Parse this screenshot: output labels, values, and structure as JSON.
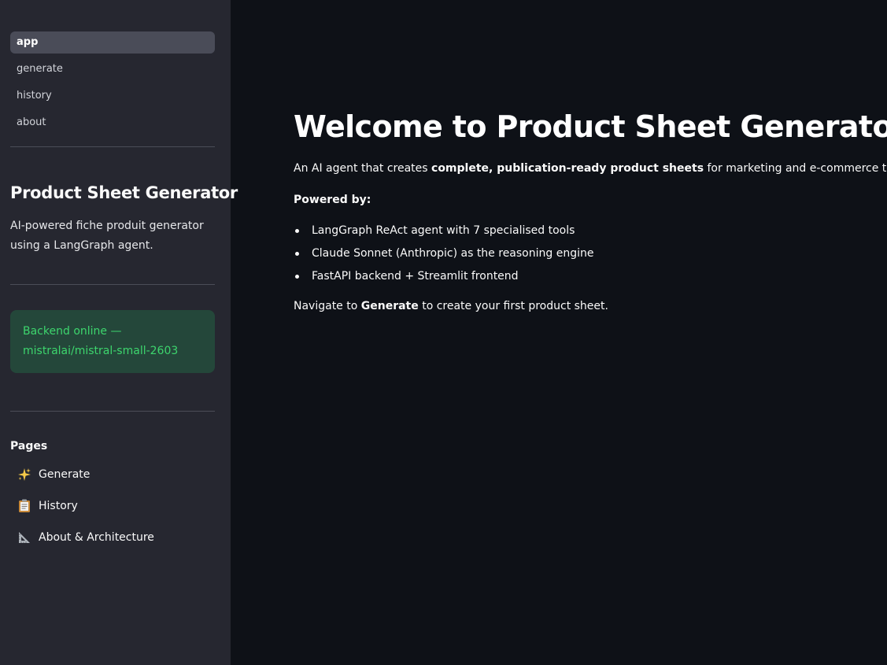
{
  "sidebar": {
    "nav": [
      {
        "label": "app",
        "active": true
      },
      {
        "label": "generate"
      },
      {
        "label": "history"
      },
      {
        "label": "about"
      }
    ],
    "title": "Product Sheet Generator",
    "description": "AI-powered fiche produit generator using a LangGraph agent.",
    "status": "Backend online — mistralai/mistral-small-2603",
    "pages_label": "Pages",
    "pages": [
      {
        "icon": "sparkles-icon",
        "label": "Generate"
      },
      {
        "icon": "clipboard-icon",
        "label": "History"
      },
      {
        "icon": "triangular-ruler-icon",
        "label": "About & Architecture"
      }
    ]
  },
  "main": {
    "title": "Welcome to Product Sheet Generator",
    "intro_pre": "An AI agent that creates ",
    "intro_bold": "complete, publication-ready product sheets",
    "intro_post": " for marketing and e-commerce teams.",
    "powered_by": "Powered by:",
    "bullets": [
      "LangGraph ReAct agent with 7 specialised tools",
      "Claude Sonnet (Anthropic) as the reasoning engine",
      "FastAPI backend + Streamlit frontend"
    ],
    "navigate_pre": "Navigate to ",
    "navigate_bold": "Generate",
    "navigate_post": " to create your first product sheet."
  },
  "colors": {
    "sidebar_bg": "#262730",
    "main_bg": "#0e1117",
    "status_bg": "#24473a",
    "status_text": "#3dd56d"
  }
}
